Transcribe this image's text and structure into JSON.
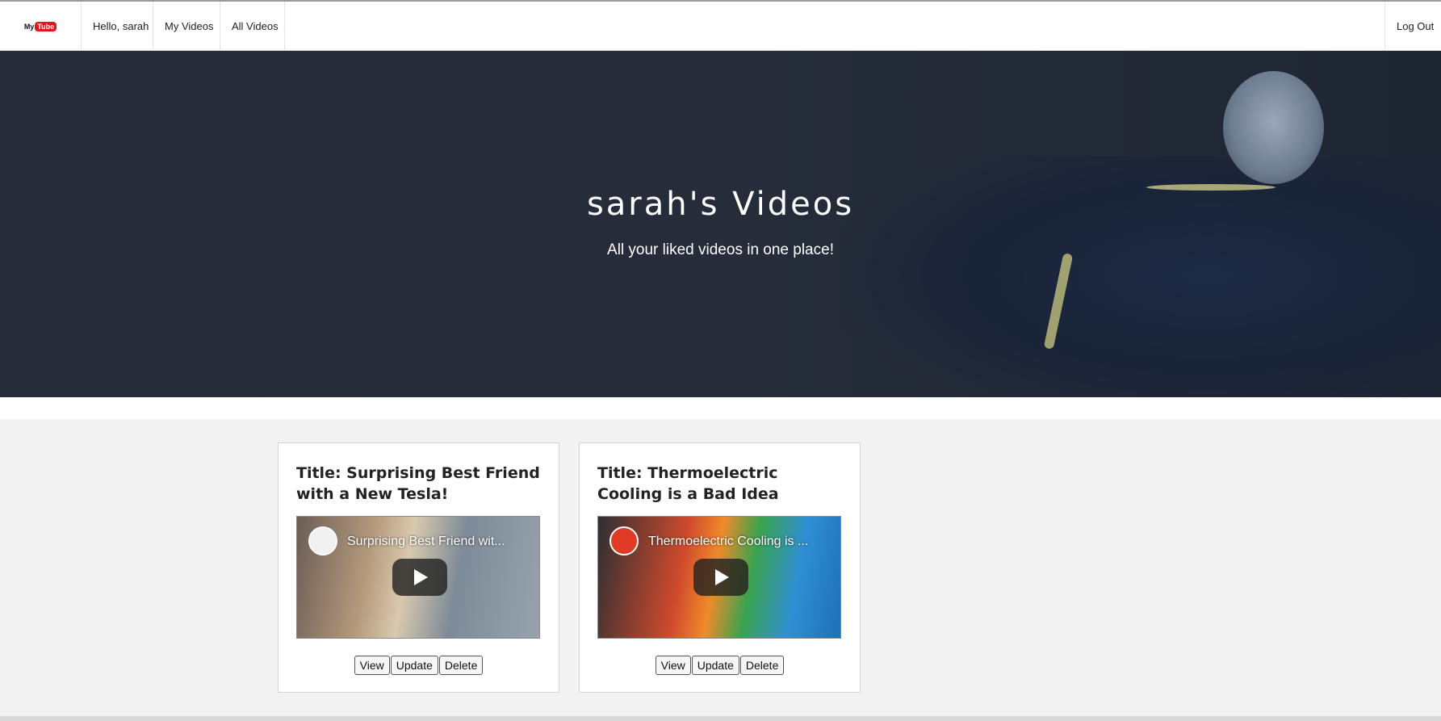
{
  "nav": {
    "brand_my": "My",
    "brand_tube": "Tube",
    "greeting": "Hello, sarah",
    "my_videos": "My Videos",
    "all_videos": "All Videos",
    "logout": "Log Out"
  },
  "hero": {
    "title": "sarah's Videos",
    "subtitle": "All your liked videos in one place!"
  },
  "videos": [
    {
      "title": "Title: Surprising Best Friend with a New Tesla!",
      "embed_title": "Surprising Best Friend wit...",
      "actions": {
        "view": "View",
        "update": "Update",
        "delete": "Delete"
      }
    },
    {
      "title": "Title: Thermoelectric Cooling is a Bad Idea",
      "embed_title": "Thermoelectric Cooling is ...",
      "actions": {
        "view": "View",
        "update": "Update",
        "delete": "Delete"
      }
    }
  ],
  "colors": {
    "brand_red": "#e0181d",
    "hero_bg": "#252b37",
    "page_bg": "#f2f2f2"
  }
}
